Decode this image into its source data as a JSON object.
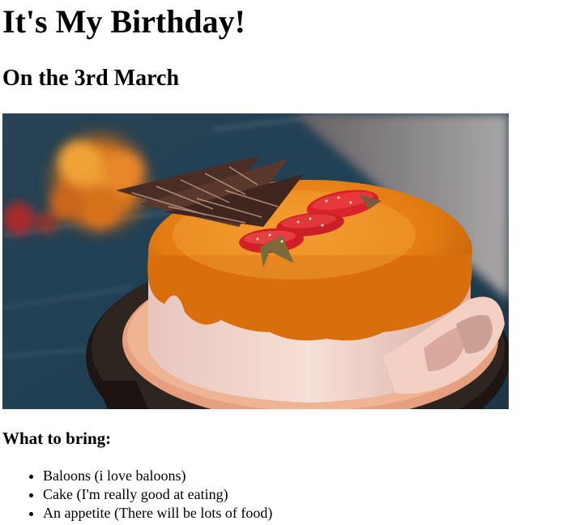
{
  "page": {
    "title": "It's My Birthday!",
    "subtitle": "On the 3rd March",
    "image": {
      "subject": "cake-photo",
      "colors": {
        "background": "#27465a",
        "glaze": "#e07a10",
        "cream": "#f2d2c8",
        "plate": "#e9a482",
        "stand": "#2a221e",
        "strawberry": "#d9222a",
        "chocolate": "#4a2e25",
        "flower": "#e8891f"
      }
    },
    "bring_heading": "What to bring:",
    "bring_items": [
      "Baloons (i love baloons)",
      "Cake (I'm really good at eating)",
      "An appetite (There will be lots of food)"
    ]
  }
}
